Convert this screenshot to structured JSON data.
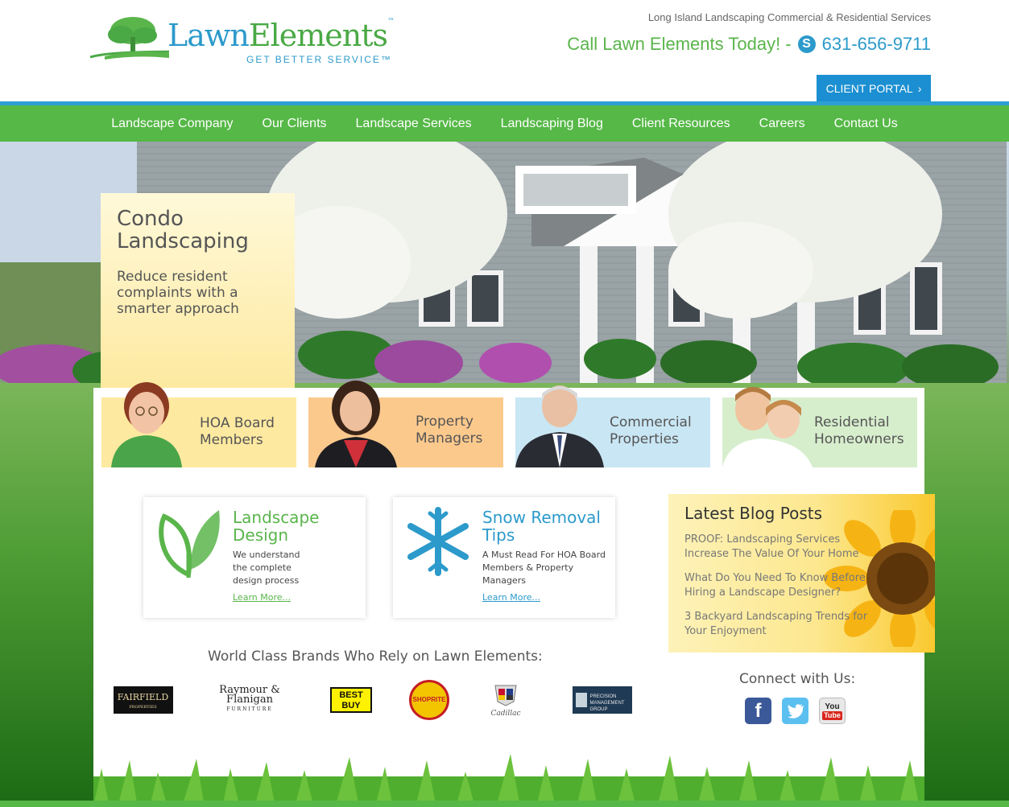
{
  "header": {
    "logo_name_part1": "Lawn",
    "logo_name_part2": "Elements",
    "logo_tm": "™",
    "logo_tagline": "GET BETTER SERVICE™",
    "tagline": "Long Island Landscaping Commercial & Residential Services",
    "call_text": "Call Lawn Elements Today! -",
    "phone": "631-656-9711",
    "portal_label": "CLIENT PORTAL",
    "portal_arrow": "›"
  },
  "nav": {
    "items": [
      {
        "label": "Landscape Company"
      },
      {
        "label": "Our Clients"
      },
      {
        "label": "Landscape Services"
      },
      {
        "label": "Landscaping Blog"
      },
      {
        "label": "Client Resources"
      },
      {
        "label": "Careers"
      },
      {
        "label": "Contact Us"
      }
    ]
  },
  "hero": {
    "title": "Condo Landscaping",
    "subtitle": "Reduce resident complaints with a smarter approach"
  },
  "audiences": [
    {
      "label": "HOA Board Members",
      "bg": "#fde9a0"
    },
    {
      "label": "Property Managers",
      "bg": "#fcc98d"
    },
    {
      "label": "Commercial Properties",
      "bg": "#c9e6f4"
    },
    {
      "label": "Residential Homeowners",
      "bg": "#d7eecd"
    }
  ],
  "features": [
    {
      "title": "Landscape Design",
      "text": "We understand the complete design process",
      "link": "Learn More...",
      "color": "#5ab54b",
      "icon": "leaf-icon"
    },
    {
      "title": "Snow Removal Tips",
      "text": "A Must Read For HOA Board Members & Property Managers",
      "link": "Learn More...",
      "color": "#2c9acb",
      "icon": "snowflake-icon"
    }
  ],
  "blog": {
    "title": "Latest Blog Posts",
    "posts": [
      "PROOF: Landscaping Services Increase The Value Of Your Home",
      "What Do You Need To Know Before Hiring a Landscape Designer?",
      "3 Backyard Landscaping Trends for Your Enjoyment"
    ]
  },
  "brands": {
    "title": "World Class Brands Who Rely on Lawn Elements:",
    "logos": [
      {
        "name": "FAIRFIELD",
        "sub": "PROPERTIES"
      },
      {
        "name": "Raymour & Flanigan",
        "sub": "FURNITURE"
      },
      {
        "name": "BEST BUY"
      },
      {
        "name": "SHOPRITE"
      },
      {
        "name": "Cadillac"
      },
      {
        "name": "PRECISION",
        "sub": "MANAGEMENT GROUP"
      }
    ]
  },
  "connect": {
    "title": "Connect with Us:",
    "facebook": "f",
    "youtube_top": "You",
    "youtube_bottom": "Tube"
  }
}
